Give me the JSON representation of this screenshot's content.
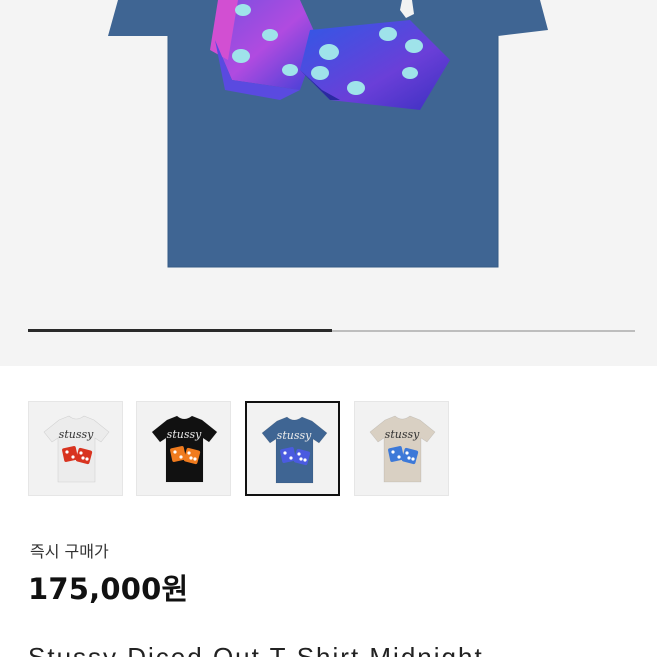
{
  "product": {
    "hero_image": "navy tee with purple-blue dice graphic",
    "gallery_progress": 0.5,
    "thumbnails": [
      {
        "name": "white-tee-thumbnail",
        "shirt_color": "#ececec",
        "dice_color": "#d8331f",
        "logo_color": "#333333",
        "selected": false
      },
      {
        "name": "black-tee-thumbnail",
        "shirt_color": "#111111",
        "dice_color": "#f07b1e",
        "logo_color": "#e8e8e8",
        "selected": false
      },
      {
        "name": "navy-tee-thumbnail",
        "shirt_color": "#3f6593",
        "dice_color": "#4a5be0",
        "logo_color": "#ececec",
        "selected": true
      },
      {
        "name": "beige-tee-thumbnail",
        "shirt_color": "#d9d0c3",
        "dice_color": "#3d79d8",
        "logo_color": "#333333",
        "selected": false
      }
    ],
    "instant_buy_label": "즉시 구매가",
    "price": "175,000원",
    "title": "Stussy Diced Out T-Shirt Midnight"
  },
  "colors": {
    "navy_shirt": "#3f6593",
    "page_bg": "#ffffff",
    "hero_bg": "#f4f4f4"
  }
}
